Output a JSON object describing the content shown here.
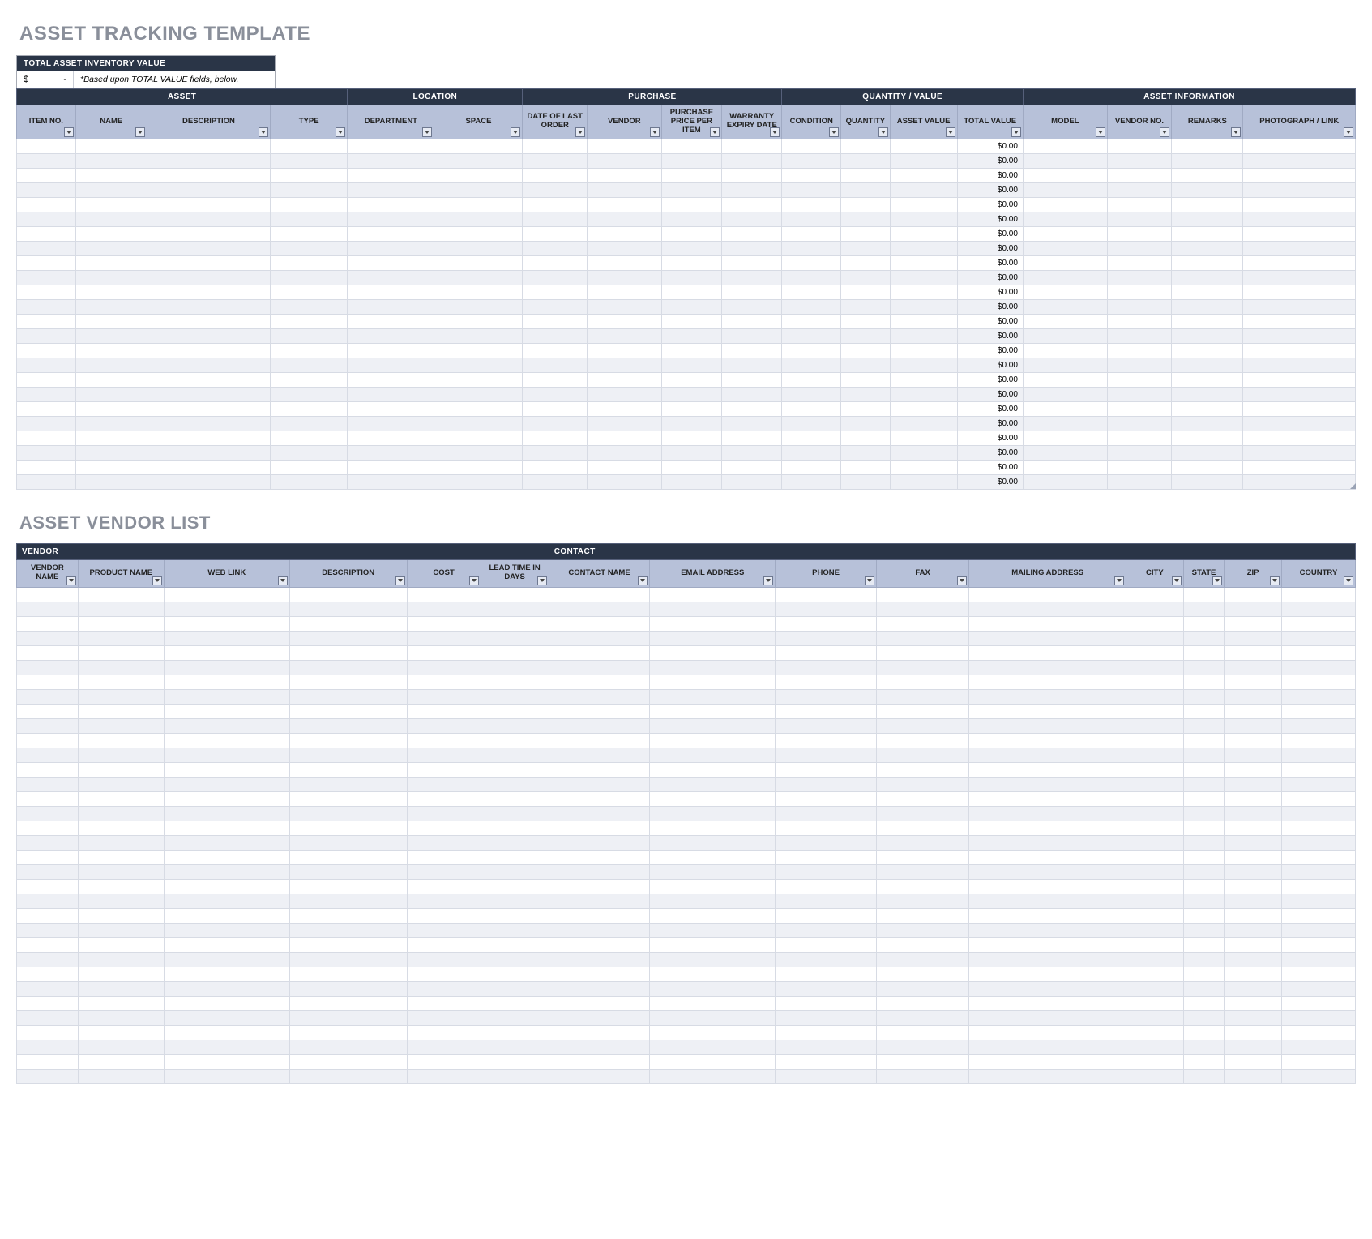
{
  "titles": {
    "main": "ASSET TRACKING TEMPLATE",
    "vendor": "ASSET VENDOR LIST"
  },
  "total_inventory": {
    "header": "TOTAL ASSET INVENTORY VALUE",
    "currency": "$",
    "value": "-",
    "note": "*Based upon TOTAL VALUE fields, below."
  },
  "asset_table": {
    "groups": [
      {
        "label": "ASSET",
        "span": 4
      },
      {
        "label": "LOCATION",
        "span": 2
      },
      {
        "label": "PURCHASE",
        "span": 4
      },
      {
        "label": "QUANTITY / VALUE",
        "span": 4
      },
      {
        "label": "ASSET INFORMATION",
        "span": 4
      }
    ],
    "columns": [
      "ITEM NO.",
      "NAME",
      "DESCRIPTION",
      "TYPE",
      "DEPARTMENT",
      "SPACE",
      "DATE OF LAST ORDER",
      "VENDOR",
      "PURCHASE PRICE PER ITEM",
      "WARRANTY EXPIRY DATE",
      "CONDITION",
      "QUANTITY",
      "ASSET VALUE",
      "TOTAL VALUE",
      "MODEL",
      "VENDOR NO.",
      "REMARKS",
      "PHOTOGRAPH / LINK"
    ],
    "row_count": 24,
    "total_value_default": "$0.00",
    "total_value_col_index": 13
  },
  "vendor_table": {
    "groups": [
      {
        "label": "VENDOR",
        "span": 6
      },
      {
        "label": "CONTACT",
        "span": 9
      }
    ],
    "columns": [
      "VENDOR NAME",
      "PRODUCT NAME",
      "WEB LINK",
      "DESCRIPTION",
      "COST",
      "LEAD TIME IN DAYS",
      "CONTACT NAME",
      "EMAIL ADDRESS",
      "PHONE",
      "FAX",
      "MAILING ADDRESS",
      "CITY",
      "STATE",
      "ZIP",
      "COUNTRY"
    ],
    "row_count": 34
  }
}
